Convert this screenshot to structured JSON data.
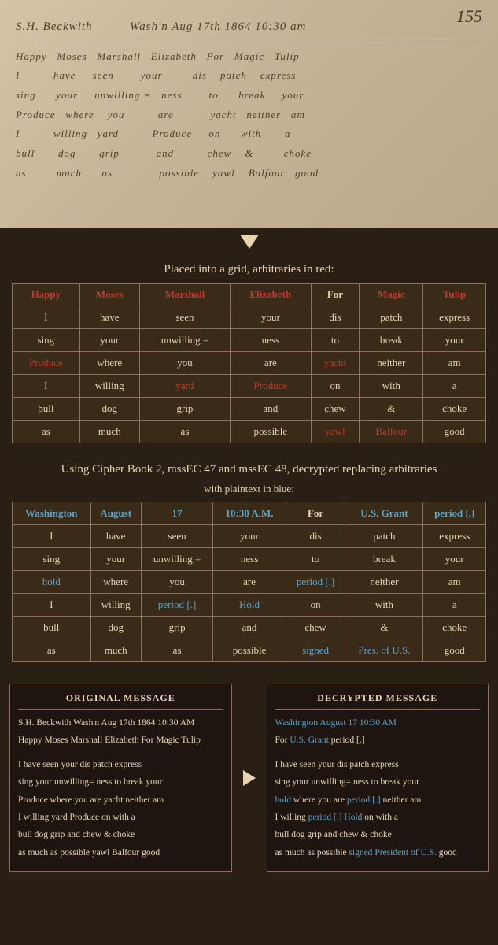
{
  "manuscript": {
    "page_number": "155",
    "header_line": "S.H. Beckwith          Wash'n Aug 17th 1864 10:30 am",
    "lines": [
      "Happy  Moses  Marshall  Elizabeth  For  Magic  Tulip",
      "I          have    seen        your        dis   patch   express",
      "sing      your    unwilling =  ness       to    break   your",
      "Produce  where   you         are          yacht  neither  am",
      "I         willing  yard        Produce     on    with     a",
      "bull       dog     grip        and         chew  &       choke",
      "as         much    as          possible    yawl  Balfour  good"
    ]
  },
  "section1": {
    "title": "Placed into a grid, arbitraries in red:",
    "headers": [
      "Happy",
      "Moses",
      "Marshall",
      "Elizabeth",
      "For",
      "Magic",
      "Tulip"
    ],
    "header_red": [
      true,
      true,
      true,
      true,
      false,
      true,
      true
    ],
    "rows": [
      [
        "I",
        "have",
        "seen",
        "your",
        "dis",
        "patch",
        "express"
      ],
      [
        "sing",
        "your",
        "unwilling =",
        "ness",
        "to",
        "break",
        "your"
      ],
      [
        "Produce",
        "where",
        "you",
        "are",
        "yacht",
        "neither",
        "am"
      ],
      [
        "I",
        "willing",
        "yard",
        "Produce",
        "on",
        "with",
        "a"
      ],
      [
        "bull",
        "dog",
        "grip",
        "and",
        "chew",
        "&",
        "choke"
      ],
      [
        "as",
        "much",
        "as",
        "possible",
        "yawl",
        "Balfour",
        "good"
      ]
    ],
    "row_red": [
      [
        false,
        false,
        false,
        false,
        false,
        false,
        false
      ],
      [
        false,
        false,
        false,
        false,
        false,
        false,
        false
      ],
      [
        true,
        false,
        false,
        false,
        true,
        false,
        false
      ],
      [
        false,
        false,
        true,
        true,
        false,
        false,
        false
      ],
      [
        false,
        false,
        false,
        false,
        false,
        false,
        false
      ],
      [
        false,
        false,
        false,
        false,
        true,
        true,
        false
      ]
    ]
  },
  "section2": {
    "title": "Using Cipher Book 2, mssEC 47 and mssEC 48, decrypted replacing arbitraries",
    "subtitle": "with plaintext in blue:",
    "headers": [
      "Washington",
      "August",
      "17",
      "10:30 A.M.",
      "For",
      "U.S. Grant",
      "period [.]"
    ],
    "header_blue": [
      true,
      true,
      true,
      true,
      false,
      true,
      true
    ],
    "rows": [
      [
        "I",
        "have",
        "seen",
        "your",
        "dis",
        "patch",
        "express"
      ],
      [
        "sing",
        "your",
        "unwilling =",
        "ness",
        "to",
        "break",
        "your"
      ],
      [
        "hold",
        "where",
        "you",
        "are",
        "period [.]",
        "neither",
        "am"
      ],
      [
        "I",
        "willing",
        "period [.]",
        "Hold",
        "on",
        "with",
        "a"
      ],
      [
        "bull",
        "dog",
        "grip",
        "and",
        "chew",
        "&",
        "choke"
      ],
      [
        "as",
        "much",
        "as",
        "possible",
        "signed",
        "Pres. of U.S.",
        "good"
      ]
    ],
    "row_blue": [
      [
        false,
        false,
        false,
        false,
        false,
        false,
        false
      ],
      [
        false,
        false,
        false,
        false,
        false,
        false,
        false
      ],
      [
        true,
        false,
        false,
        false,
        true,
        false,
        false
      ],
      [
        false,
        false,
        true,
        true,
        false,
        false,
        false
      ],
      [
        false,
        false,
        false,
        false,
        false,
        false,
        false
      ],
      [
        false,
        false,
        false,
        false,
        true,
        true,
        false
      ]
    ]
  },
  "original_message": {
    "title": "ORIGINAL MESSAGE",
    "header1": "S.H. Beckwith Wash'n Aug 17th 1864 10:30 AM",
    "header2": "Happy Moses Marshall Elizabeth For Magic Tulip",
    "body": [
      "I have seen your dis patch express",
      "sing your unwilling= ness to break your",
      "Produce where you are yacht neither am",
      "I willing yard Produce on with a",
      "bull dog grip and chew & choke",
      "as much as possible yawl Balfour good"
    ]
  },
  "decrypted_message": {
    "title": "DECRYPTED MESSAGE",
    "header1_blue": "Washington August 17 10:30 AM",
    "header2_part1": "For ",
    "header2_blue": "U.S. Grant",
    "header2_part2": " period [.]",
    "body": [
      "I have seen your dis patch express",
      "sing your unwilling= ness to break your",
      {
        "text": " where you are ",
        "blue_before": "hold",
        "blue_after": "period [.]",
        "suffix": " neither am"
      },
      {
        "text": "I willing ",
        "blue1": "period [.]",
        "mid": " ",
        "blue2": "Hold",
        "suffix": " on with a"
      },
      "bull dog grip and chew & choke",
      {
        "text": "as much as possible ",
        "blue1": "signed",
        "mid": " ",
        "blue2": "President of U.S.",
        "suffix": " good"
      }
    ]
  }
}
